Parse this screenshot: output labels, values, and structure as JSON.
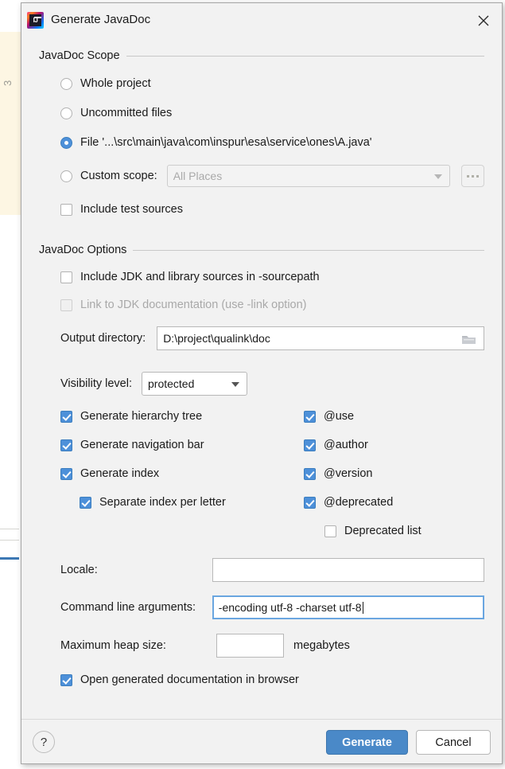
{
  "window": {
    "title": "Generate JavaDoc",
    "app_icon": "intellij-idea-icon",
    "close_icon": "close-icon"
  },
  "scope_section": {
    "header": "JavaDoc Scope",
    "options": [
      {
        "label": "Whole project",
        "mnemonic": "p",
        "selected": false
      },
      {
        "label": "Uncommitted files",
        "mnemonic": "U",
        "selected": false
      },
      {
        "label": "File '...\\src\\main\\java\\com\\inspur\\esa\\service\\ones\\A.java'",
        "mnemonic": "F",
        "selected": true
      }
    ],
    "custom_scope": {
      "label": "Custom scope:",
      "mnemonic": "C",
      "selected": false,
      "value": "All Places",
      "disabled": true,
      "browse_label": "...",
      "browse_icon": "ellipsis-icon"
    },
    "include_test_sources": {
      "label": "Include test sources",
      "mnemonic": "t",
      "checked": false
    }
  },
  "options_section": {
    "header": "JavaDoc Options",
    "include_jdk_sources": {
      "label": "Include JDK and library sources in -sourcepath",
      "checked": false,
      "disabled": false
    },
    "link_jdk_docs": {
      "label": "Link to JDK documentation (use -link option)",
      "checked": false,
      "disabled": true
    },
    "output_directory": {
      "label": "Output directory:",
      "mnemonic": "d",
      "value": "D:\\project\\qualink\\doc",
      "browse_icon": "folder-icon"
    },
    "visibility_level": {
      "label": "Visibility level:",
      "value": "protected",
      "dropdown_icon": "chevron-down-icon"
    },
    "checkboxes_left": [
      {
        "label": "Generate hierarchy tree",
        "checked": true,
        "indent": 0
      },
      {
        "label": "Generate navigation bar",
        "checked": true,
        "indent": 0
      },
      {
        "label": "Generate index",
        "checked": true,
        "indent": 0
      },
      {
        "label": "Separate index per letter",
        "checked": true,
        "indent": 1
      }
    ],
    "checkboxes_right": [
      {
        "label": "@use",
        "checked": true,
        "indent": 0
      },
      {
        "label": "@author",
        "checked": true,
        "indent": 0
      },
      {
        "label": "@version",
        "checked": true,
        "indent": 0
      },
      {
        "label": "@deprecated",
        "checked": true,
        "indent": 0
      },
      {
        "label": "Deprecated list",
        "checked": false,
        "indent": 1
      }
    ],
    "locale": {
      "label": "Locale:",
      "mnemonic": "L",
      "value": ""
    },
    "command_line_arguments": {
      "label": "Command line arguments:",
      "value": "-encoding utf-8 -charset utf-8",
      "focused": true
    },
    "maximum_heap_size": {
      "label": "Maximum heap size:",
      "mnemonic": "M",
      "value": "",
      "units": "megabytes"
    },
    "open_in_browser": {
      "label": "Open generated documentation in browser",
      "mnemonic": "g",
      "checked": true
    }
  },
  "footer": {
    "help_label": "?",
    "help_icon": "help-icon",
    "generate_label": "Generate",
    "cancel_label": "Cancel"
  },
  "backdrop": {
    "gutter_number": "3"
  },
  "colors": {
    "accent": "#4d90d9",
    "primary_button": "#4a89c8",
    "dialog_bg": "#f2f2f2",
    "disabled_text": "#a9a9a9"
  }
}
